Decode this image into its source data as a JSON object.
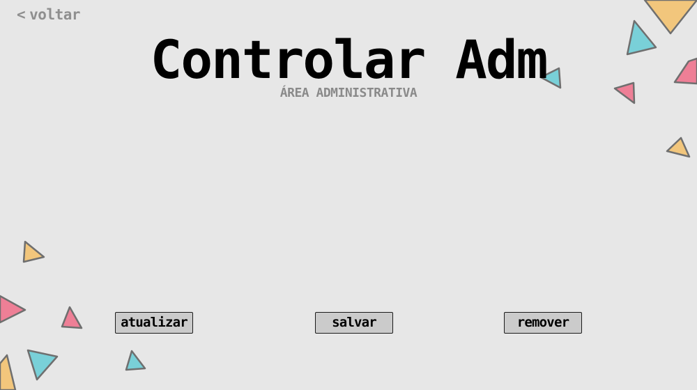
{
  "nav": {
    "back_label": "voltar"
  },
  "header": {
    "title": "Controlar Adm",
    "subtitle": "ÁREA ADMINISTRATIVA"
  },
  "actions": {
    "update_label": "atualizar",
    "save_label": "salvar",
    "remove_label": "remover"
  },
  "theme": {
    "background": "#e7e7e7",
    "triangle_yellow": "#f2c67c",
    "triangle_teal": "#79d0d8",
    "triangle_pink": "#ee7f96",
    "button_background": "#cbcbcb"
  }
}
